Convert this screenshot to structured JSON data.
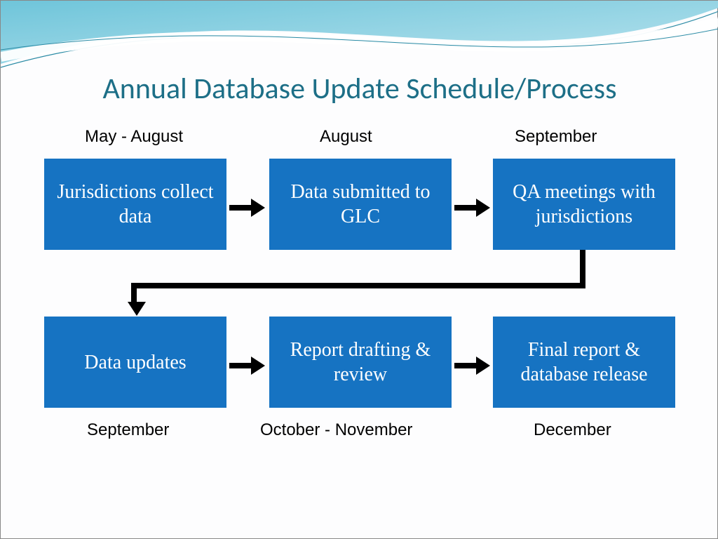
{
  "title": "Annual Database Update Schedule/Process",
  "steps": [
    {
      "period": "May - August",
      "label": "Jurisdictions collect data"
    },
    {
      "period": "August",
      "label": "Data submitted to GLC"
    },
    {
      "period": "September",
      "label": "QA meetings with jurisdictions"
    },
    {
      "period": "September",
      "label": "Data updates"
    },
    {
      "period": "October - November",
      "label": "Report drafting & review"
    },
    {
      "period": "December",
      "label": "Final report & database release"
    }
  ],
  "colors": {
    "box_bg": "#1673c2",
    "title_color": "#1d6f87"
  }
}
